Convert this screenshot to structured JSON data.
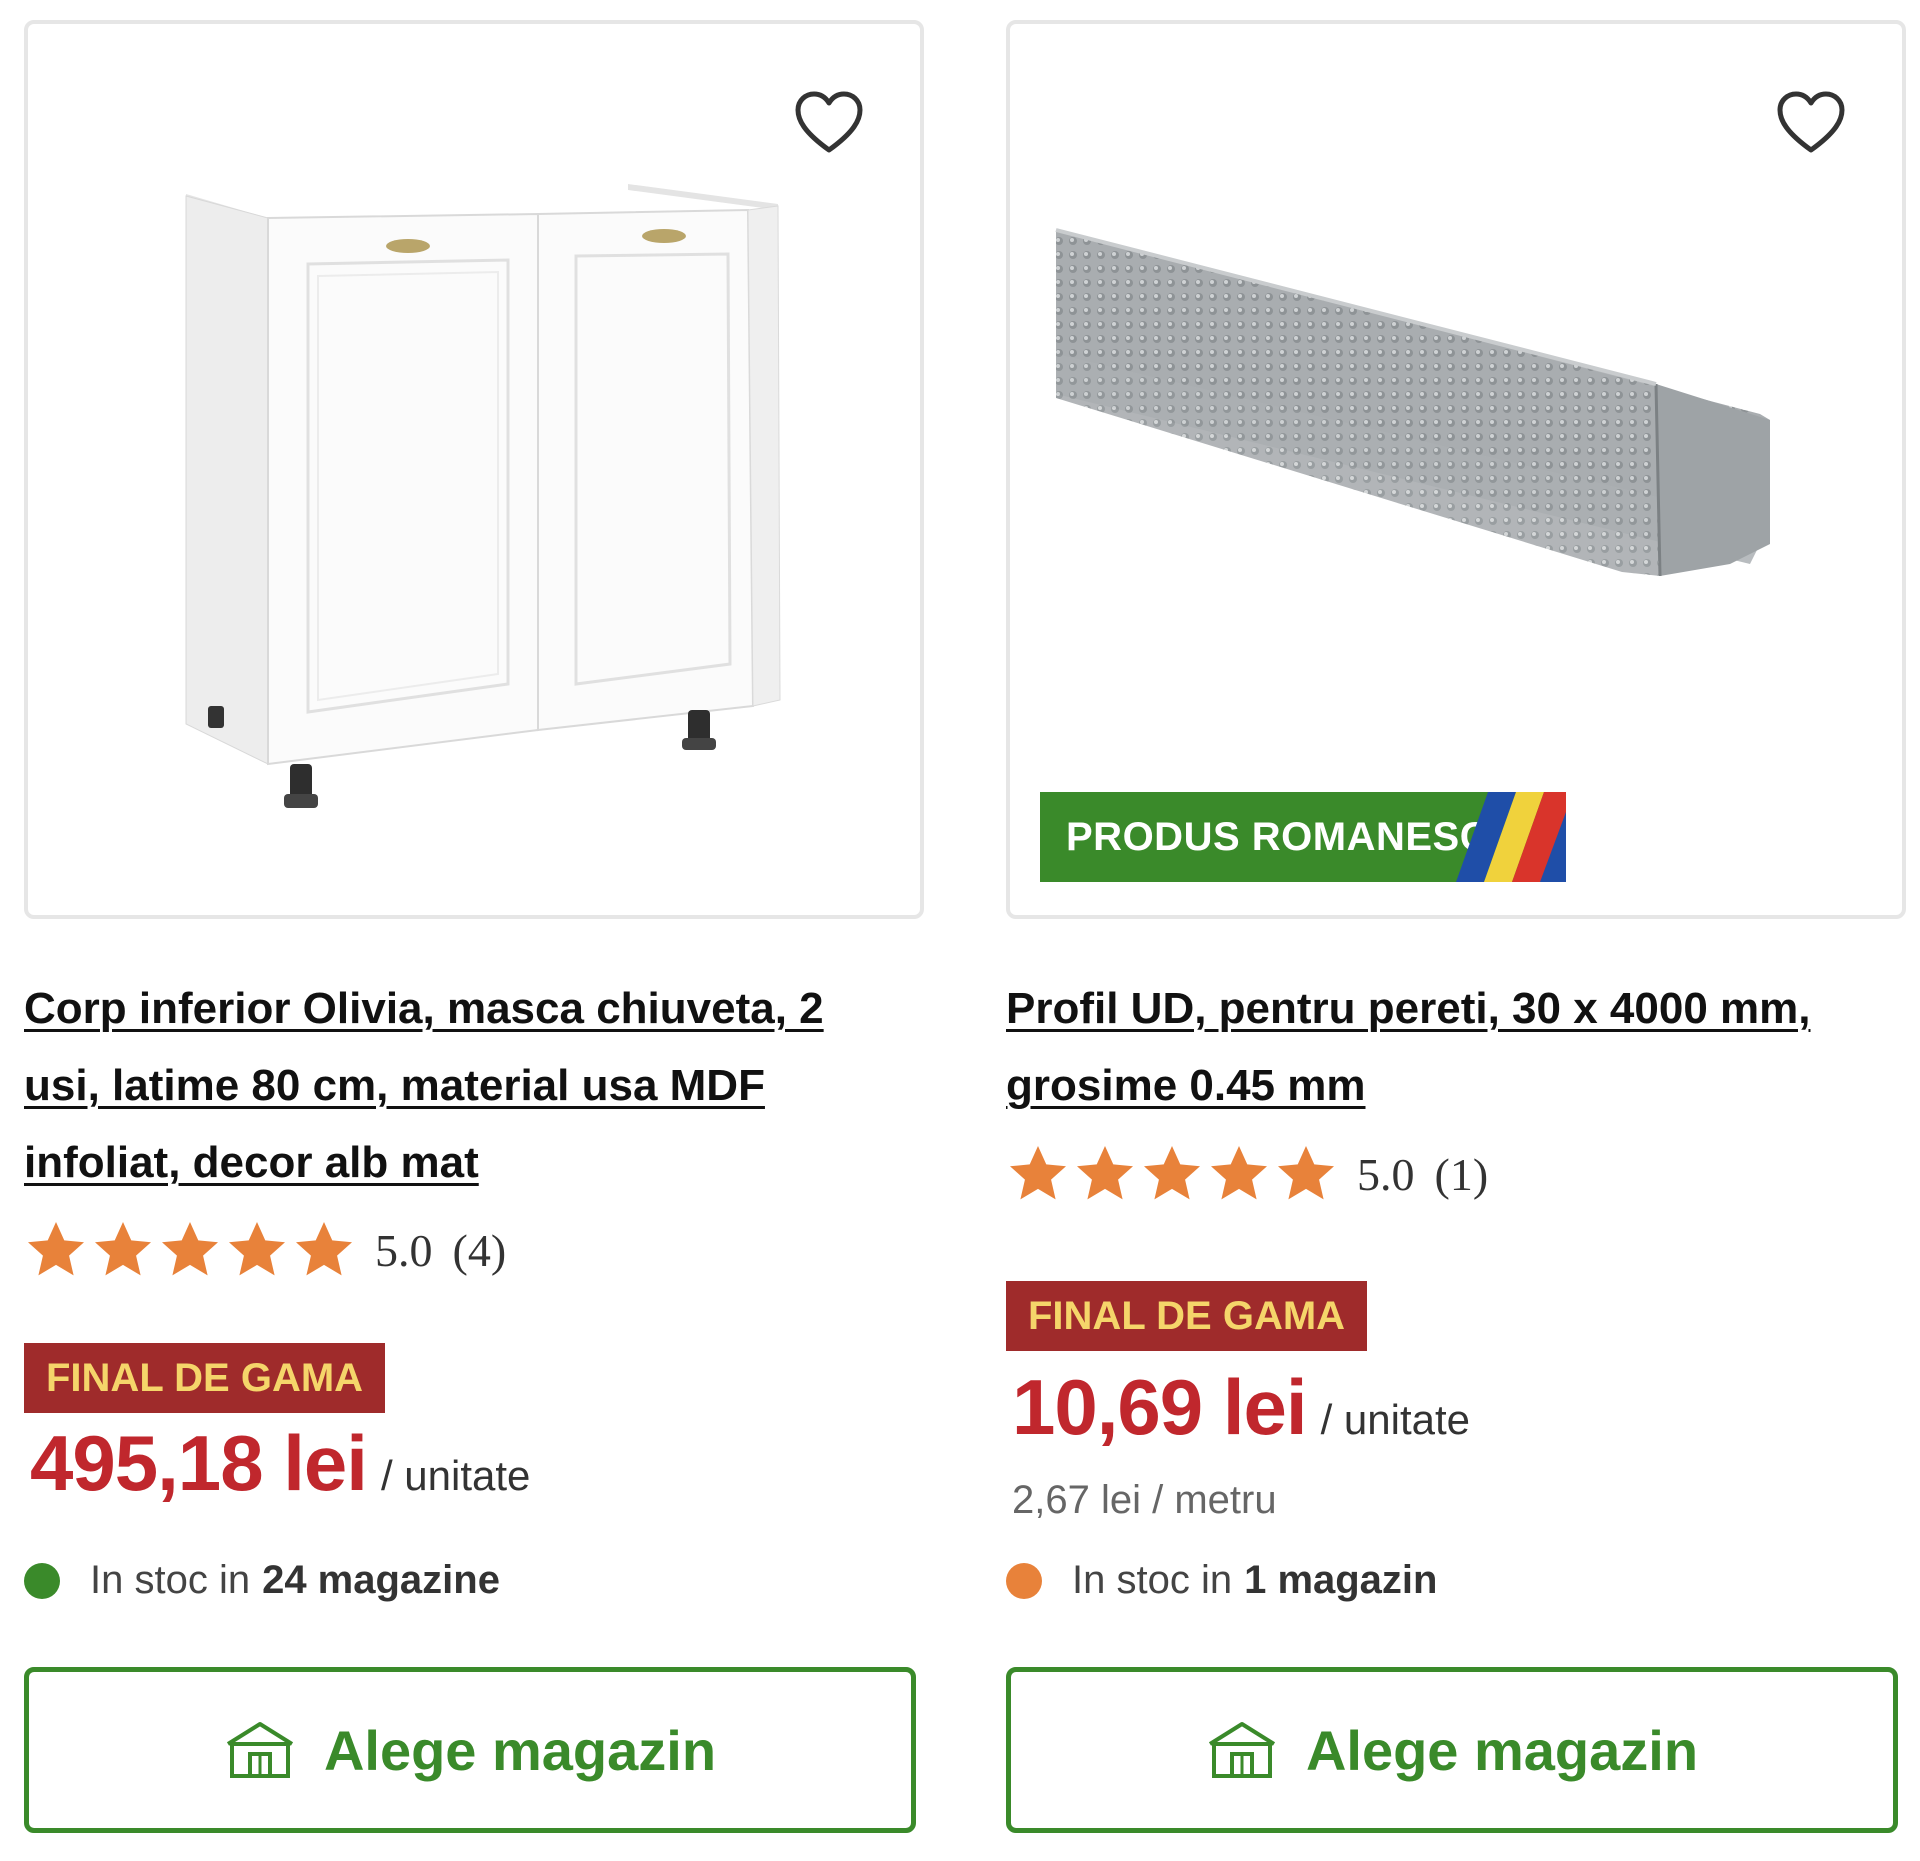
{
  "products": [
    {
      "title": "Corp inferior Olivia, masca chiuveta, 2 usi, latime 80 cm, material usa MDF infoliat, decor alb mat",
      "rating_score": "5.0",
      "rating_count": "(4)",
      "stars": 5,
      "badge": "FINAL DE GAMA",
      "price": "495,18 lei",
      "unit": "/ unitate",
      "stock_label": "In stoc in",
      "stock_strong": "24 magazine",
      "stock_color": "#3a8a2a",
      "button_label": "Alege magazin",
      "image_icon": "kitchen-cabinet-image"
    },
    {
      "title": "Profil UD, pentru pereti, 30 x 4000 mm, grosime 0.45 mm",
      "rating_score": "5.0",
      "rating_count": "(1)",
      "stars": 5,
      "origin_badge": "PRODUS ROMANESC",
      "badge": "FINAL DE GAMA",
      "price": "10,69 lei",
      "unit": "/ unitate",
      "unit_price": "2,67 lei / metru",
      "stock_label": "In stoc in",
      "stock_strong": "1 magazin",
      "stock_color": "#e8823a",
      "button_label": "Alege magazin",
      "image_icon": "metal-profile-image"
    }
  ],
  "colors": {
    "brand_green": "#3a8a2a",
    "price_red": "#c0272d",
    "badge_red": "#9f2b2b",
    "badge_text": "#f5d56a",
    "star_orange": "#e8823a"
  }
}
